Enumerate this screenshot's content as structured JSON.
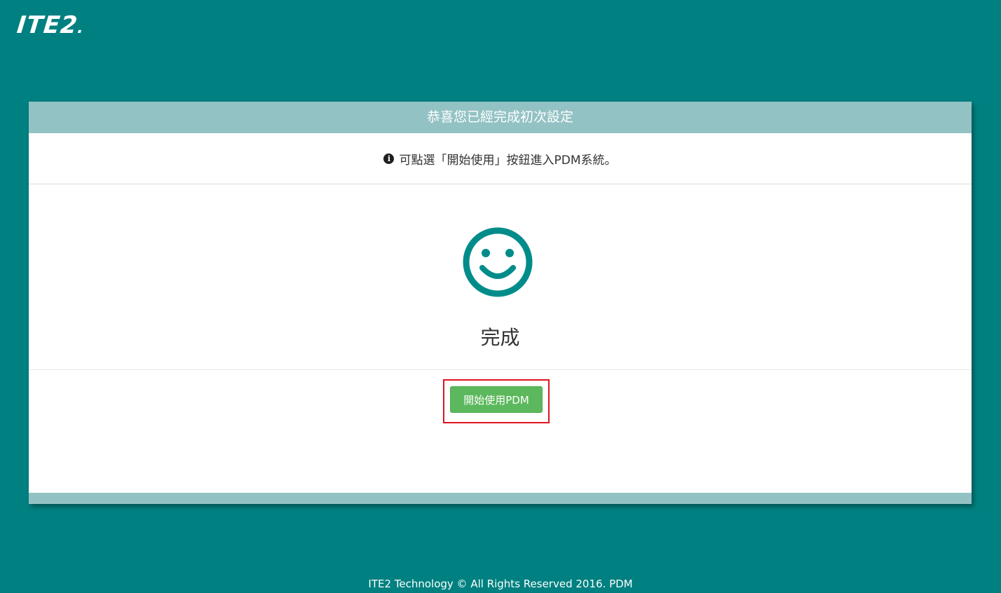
{
  "logo": {
    "text": "ITE2",
    "dot": "."
  },
  "panel": {
    "header_title": "恭喜您已經完成初次設定",
    "info_text": "可點選「開始使用」按鈕進入PDM系統。",
    "info_icon": "info-circle-icon",
    "smiley_icon": "smiley-icon",
    "done_label": "完成",
    "start_button_label": "開始使用PDM"
  },
  "footer": {
    "copyright": "ITE2 Technology © All Rights Reserved 2016. PDM"
  },
  "colors": {
    "background": "#008080",
    "panel_header": "#93c2c4",
    "accent": "#008c8a",
    "button": "#5cb85c",
    "highlight": "#e0141e"
  }
}
